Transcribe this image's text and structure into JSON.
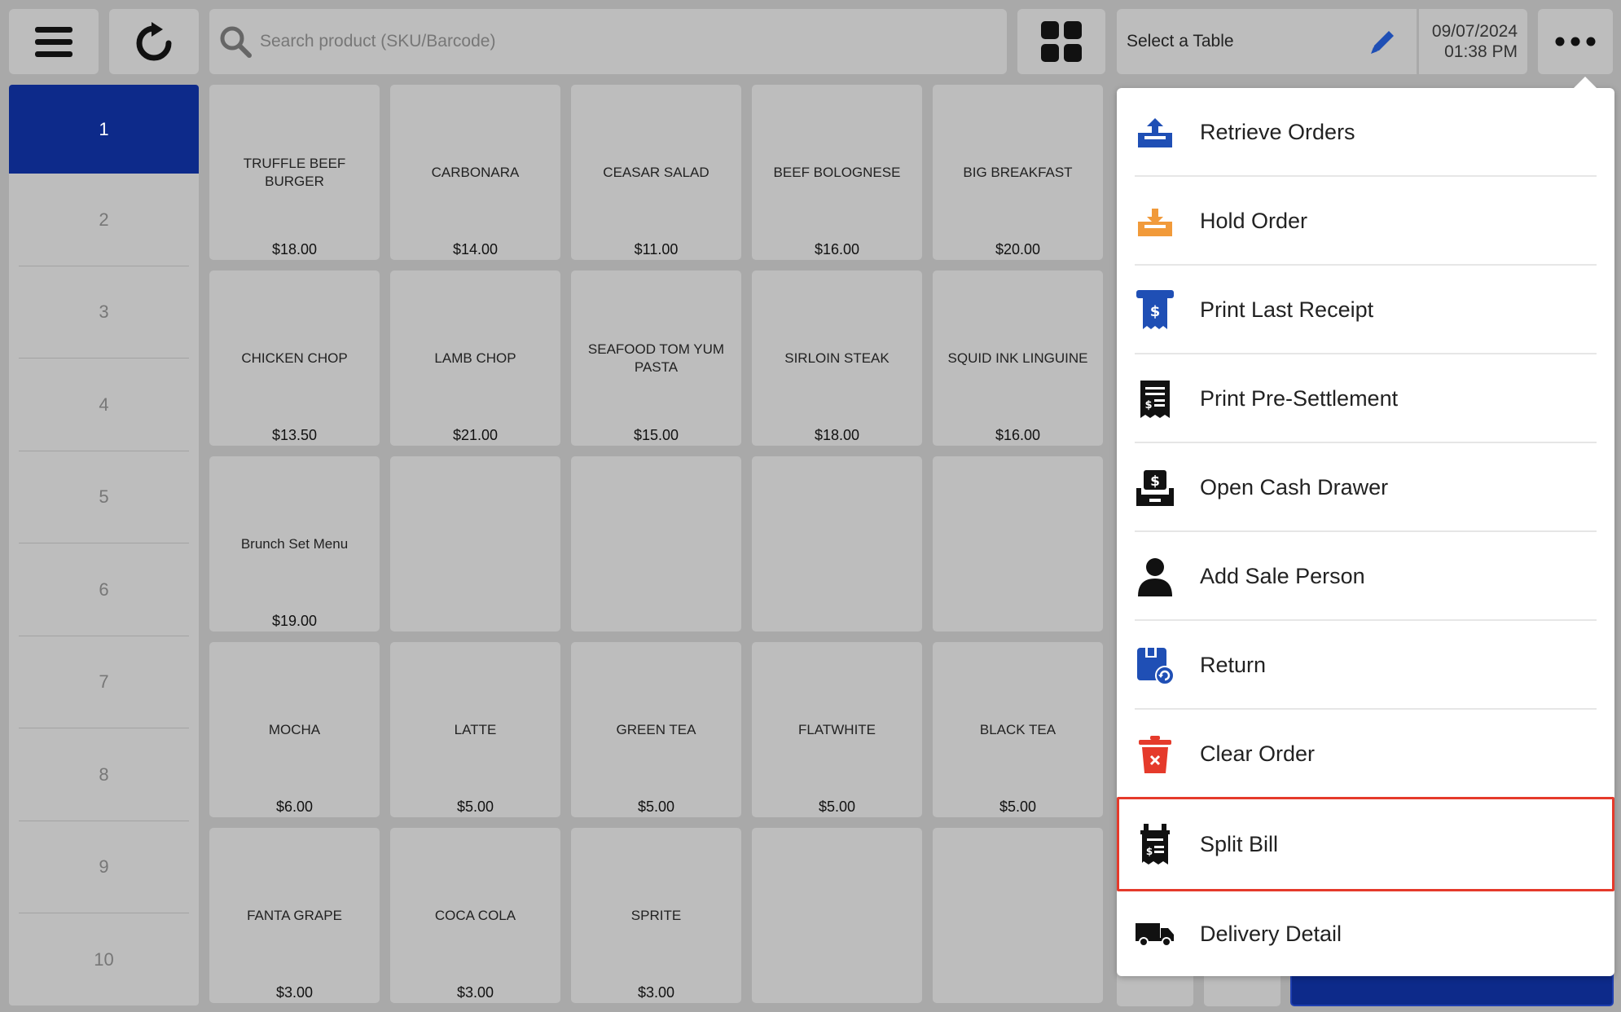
{
  "topbar": {
    "search_placeholder": "Search product (SKU/Barcode)",
    "table_label": "Select a Table",
    "date": "09/07/2024",
    "time": "01:38 PM"
  },
  "categories": [
    "1",
    "2",
    "3",
    "4",
    "5",
    "6",
    "7",
    "8",
    "9",
    "10"
  ],
  "products": [
    {
      "name": "TRUFFLE BEEF BURGER",
      "price": "$18.00"
    },
    {
      "name": "CARBONARA",
      "price": "$14.00"
    },
    {
      "name": "CEASAR SALAD",
      "price": "$11.00"
    },
    {
      "name": "BEEF BOLOGNESE",
      "price": "$16.00"
    },
    {
      "name": "BIG BREAKFAST",
      "price": "$20.00"
    },
    {
      "name": "CHICKEN CHOP",
      "price": "$13.50"
    },
    {
      "name": "LAMB CHOP",
      "price": "$21.00"
    },
    {
      "name": "SEAFOOD TOM YUM PASTA",
      "price": "$15.00"
    },
    {
      "name": "SIRLOIN STEAK",
      "price": "$18.00"
    },
    {
      "name": "SQUID INK LINGUINE",
      "price": "$16.00"
    },
    {
      "name": "Brunch Set Menu",
      "price": "$19.00"
    },
    {
      "name": "",
      "price": ""
    },
    {
      "name": "",
      "price": ""
    },
    {
      "name": "",
      "price": ""
    },
    {
      "name": "",
      "price": ""
    },
    {
      "name": "MOCHA",
      "price": "$6.00"
    },
    {
      "name": "LATTE",
      "price": "$5.00"
    },
    {
      "name": "GREEN TEA",
      "price": "$5.00"
    },
    {
      "name": "FLATWHITE",
      "price": "$5.00"
    },
    {
      "name": "BLACK TEA",
      "price": "$5.00"
    },
    {
      "name": "FANTA GRAPE",
      "price": "$3.00"
    },
    {
      "name": "COCA COLA",
      "price": "$3.00"
    },
    {
      "name": "SPRITE",
      "price": "$3.00"
    },
    {
      "name": "",
      "price": ""
    },
    {
      "name": "",
      "price": ""
    }
  ],
  "dropdown": {
    "items": [
      {
        "label": "Retrieve Orders",
        "icon": "upload-tray-icon"
      },
      {
        "label": "Hold Order",
        "icon": "download-tray-icon"
      },
      {
        "label": "Print Last Receipt",
        "icon": "receipt-dollar-icon"
      },
      {
        "label": "Print Pre-Settlement",
        "icon": "bill-list-icon"
      },
      {
        "label": "Open Cash Drawer",
        "icon": "cash-drawer-icon"
      },
      {
        "label": "Add Sale Person",
        "icon": "person-icon"
      },
      {
        "label": "Return",
        "icon": "return-bag-icon"
      },
      {
        "label": "Clear Order",
        "icon": "trash-icon"
      },
      {
        "label": "Split Bill",
        "icon": "split-bill-icon"
      },
      {
        "label": "Delivery Detail",
        "icon": "truck-icon"
      }
    ],
    "highlighted_item": "Split Bill"
  },
  "colors": {
    "accent": "#0d2a8a",
    "icon_blue": "#1f4fb5",
    "icon_orange": "#f19a3a",
    "icon_red": "#e53a2b",
    "highlight_border": "#e53a2b"
  }
}
